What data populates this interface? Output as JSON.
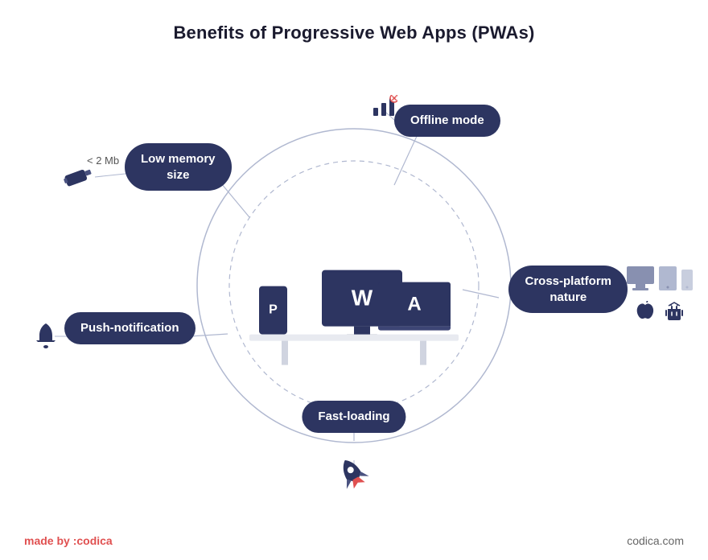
{
  "title": "Benefits of Progressive Web Apps (PWAs)",
  "pills": {
    "low_memory": "Low memory\nsize",
    "offline": "Offline mode",
    "cross_platform": "Cross-platform\nnature",
    "push": "Push-notification",
    "fast_loading": "Fast-loading"
  },
  "label_2mb": "< 2 Mb",
  "footer": {
    "made_by_prefix": "made by",
    "made_by_brand": ":codica",
    "url": "codica.com"
  },
  "icons": {
    "usb": "🔌",
    "bell": "🔔",
    "rocket": "🚀",
    "apple": "",
    "android": ""
  },
  "monitor_letter": "W",
  "laptop_letter": "A",
  "phone_letter": "P",
  "colors": {
    "pill_bg": "#2d3561",
    "pill_text": "#ffffff",
    "line": "#b0b8d0",
    "accent_red": "#e05050"
  }
}
